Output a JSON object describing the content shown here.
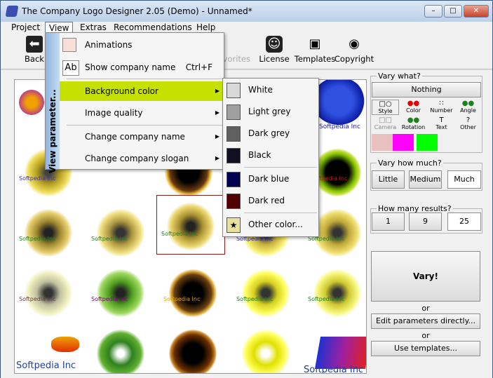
{
  "window": {
    "title": "The Company Logo Designer 2.05 (Demo) - Unnamed*"
  },
  "menubar": [
    "Project",
    "View",
    "Extras",
    "Recommendations",
    "Help"
  ],
  "toolbar": {
    "back": "Back",
    "favorites": "Favorites",
    "license": "License",
    "templates": "Templates",
    "copyright": "Copyright"
  },
  "view_menu": {
    "strip_label": "View parameter...",
    "items": [
      {
        "label": "Animations",
        "shortcut": ""
      },
      {
        "label": "Show company name",
        "shortcut": "Ctrl+F"
      },
      {
        "label": "Background color",
        "shortcut": ""
      },
      {
        "label": "Image quality",
        "shortcut": ""
      },
      {
        "label": "Change company name",
        "shortcut": ""
      },
      {
        "label": "Change company slogan",
        "shortcut": ""
      }
    ]
  },
  "bg_submenu": {
    "items": [
      {
        "label": "White",
        "color": "#d8d8d8"
      },
      {
        "label": "Light grey",
        "color": "#a0a0a0"
      },
      {
        "label": "Dark grey",
        "color": "#606060"
      },
      {
        "label": "Black",
        "color": "#101020"
      },
      {
        "label": "Dark blue",
        "color": "#000050"
      },
      {
        "label": "Dark red",
        "color": "#500000"
      },
      {
        "label": "Other color...",
        "color": "#e8e0a0"
      }
    ]
  },
  "right_panel": {
    "vary_what": "Vary what?",
    "nothing": "Nothing",
    "cells": [
      "Style",
      "Color",
      "Number",
      "Angle",
      "Camera",
      "Rotation",
      "Text",
      "Other"
    ],
    "how_much_title": "Vary how much?",
    "how_much": [
      "Little",
      "Medium",
      "Much"
    ],
    "results_title": "How many results?",
    "results": [
      "1",
      "9",
      "25"
    ],
    "vary": "Vary!",
    "or1": "or",
    "edit": "Edit parameters directly...",
    "or2": "or",
    "templates": "Use templates..."
  },
  "thumbs": {
    "softpedia_inc": "Softpedia Inc",
    "softpedia": "Softpedia Inc"
  },
  "colors": {
    "highlight": "#c6e000",
    "menu_strip": "#8fb4de"
  }
}
